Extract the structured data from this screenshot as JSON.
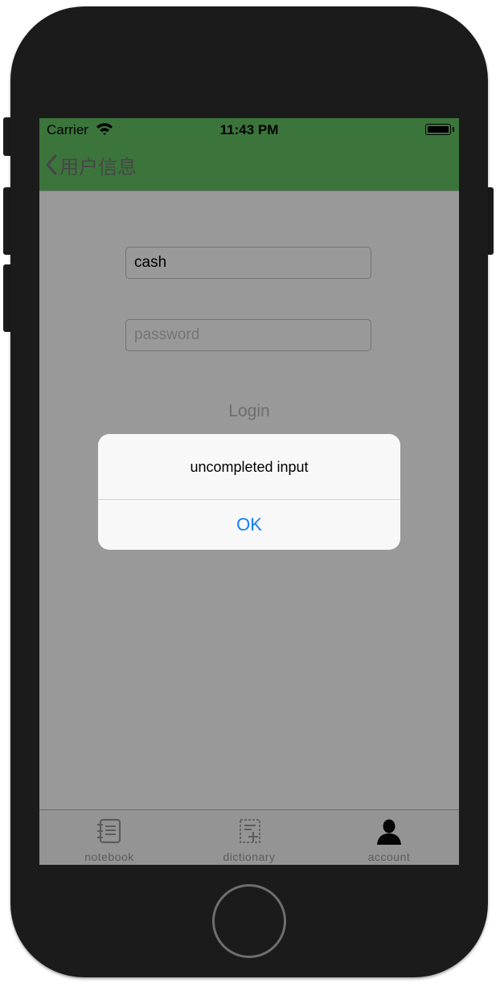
{
  "status_bar": {
    "carrier": "Carrier",
    "time": "11:43 PM"
  },
  "nav": {
    "back_title": "用户信息"
  },
  "form": {
    "username_value": "cash",
    "password_placeholder": "password",
    "login_label": "Login"
  },
  "alert": {
    "message": "uncompleted input",
    "ok_label": "OK"
  },
  "tabbar": {
    "items": [
      {
        "label": "notebook",
        "icon": "notebook-icon"
      },
      {
        "label": "dictionary",
        "icon": "dictionary-icon"
      },
      {
        "label": "account",
        "icon": "account-icon"
      }
    ]
  },
  "colors": {
    "nav_background": "#63c364",
    "alert_button": "#147efb",
    "device_frame": "#1b1b1b"
  }
}
